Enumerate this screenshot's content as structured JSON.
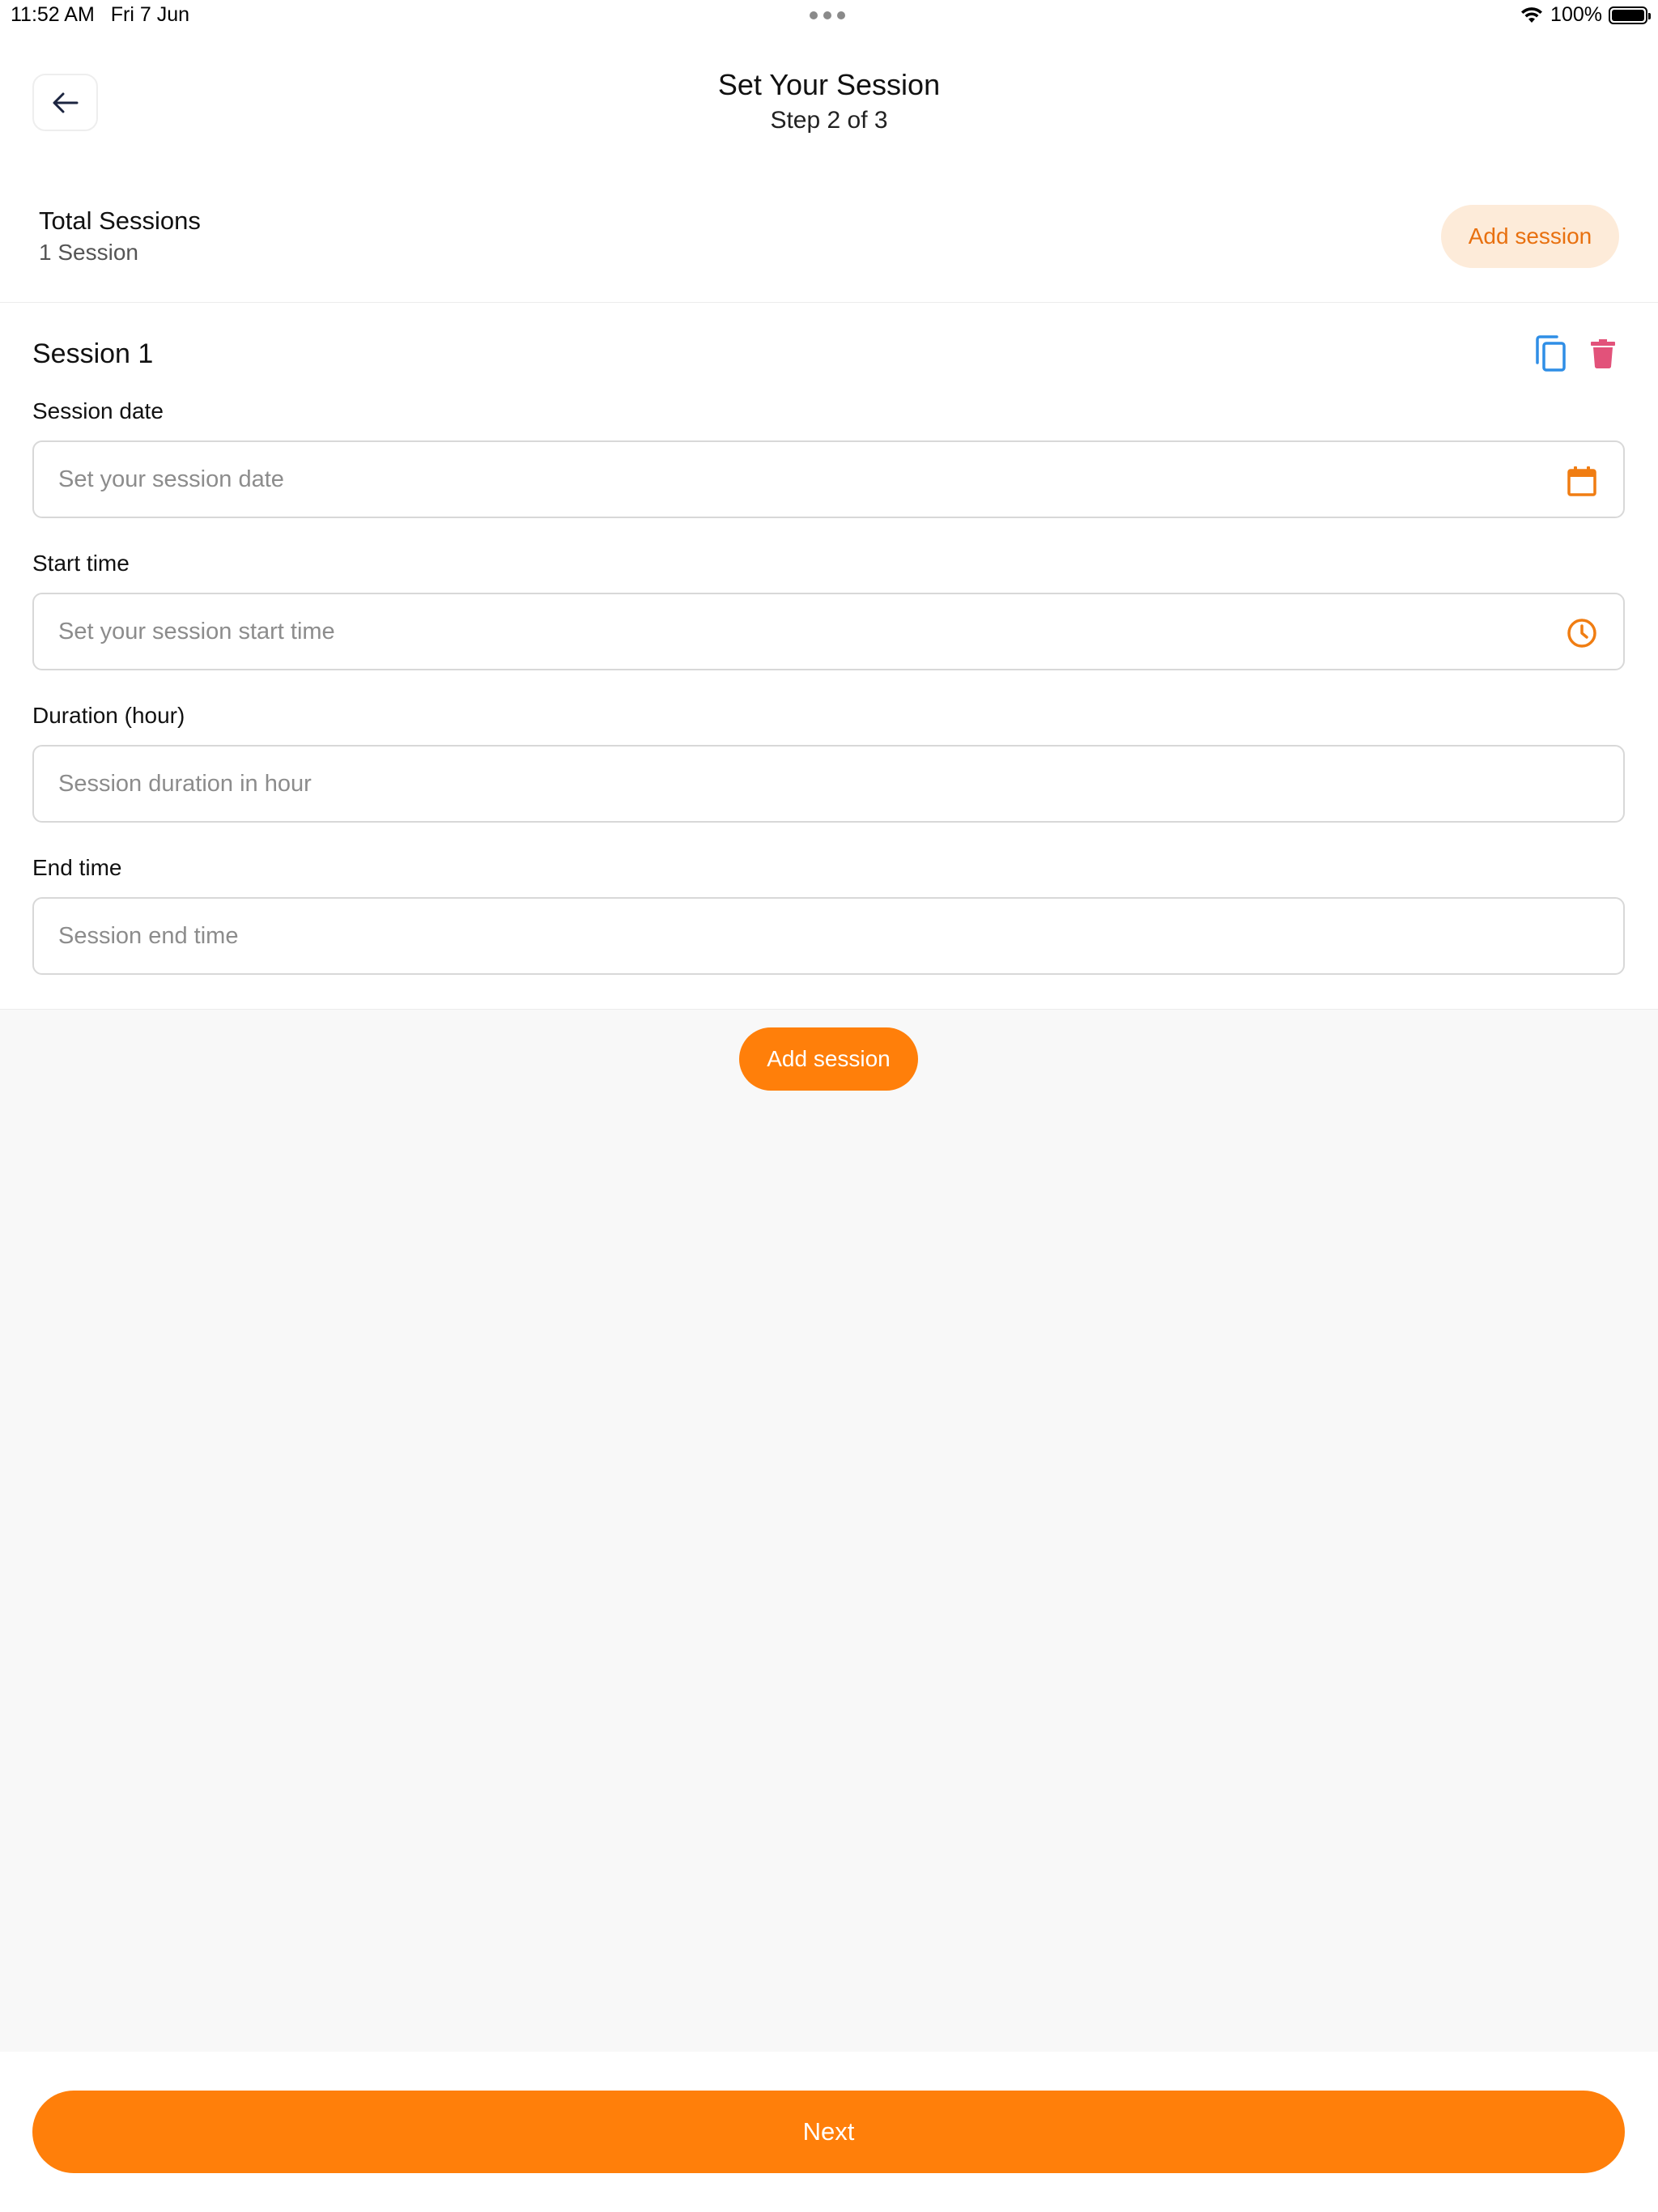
{
  "status_bar": {
    "time": "11:52 AM",
    "date": "Fri 7 Jun",
    "battery": "100%",
    "icons": [
      "wifi-icon",
      "battery-icon",
      "multitasking-dots-icon"
    ]
  },
  "header": {
    "title": "Set Your Session",
    "subtitle": "Step 2 of 3",
    "back_icon": "arrow-left-icon"
  },
  "summary": {
    "label": "Total Sessions",
    "count": "1 Session",
    "add_button": "Add session"
  },
  "session": {
    "title": "Session 1",
    "actions": {
      "copy_icon": "copy-icon",
      "delete_icon": "trash-icon"
    },
    "fields": [
      {
        "label": "Session date",
        "placeholder": "Set your session date",
        "value": "",
        "icon": "calendar-icon"
      },
      {
        "label": "Start time",
        "placeholder": "Set your session start time",
        "value": "",
        "icon": "clock-icon"
      },
      {
        "label": "Duration (hour)",
        "placeholder": "Session duration in hour",
        "value": ""
      },
      {
        "label": "End time",
        "placeholder": "Session end time",
        "value": ""
      }
    ]
  },
  "add_session_button": "Add session",
  "footer": {
    "next_button": "Next"
  },
  "colors": {
    "accent": "#ff7f0a",
    "accent_light": "#fdebd9",
    "copy_icon": "#2f8ee6",
    "delete_icon": "#e2527a",
    "background_gray": "#f8f8f8"
  }
}
